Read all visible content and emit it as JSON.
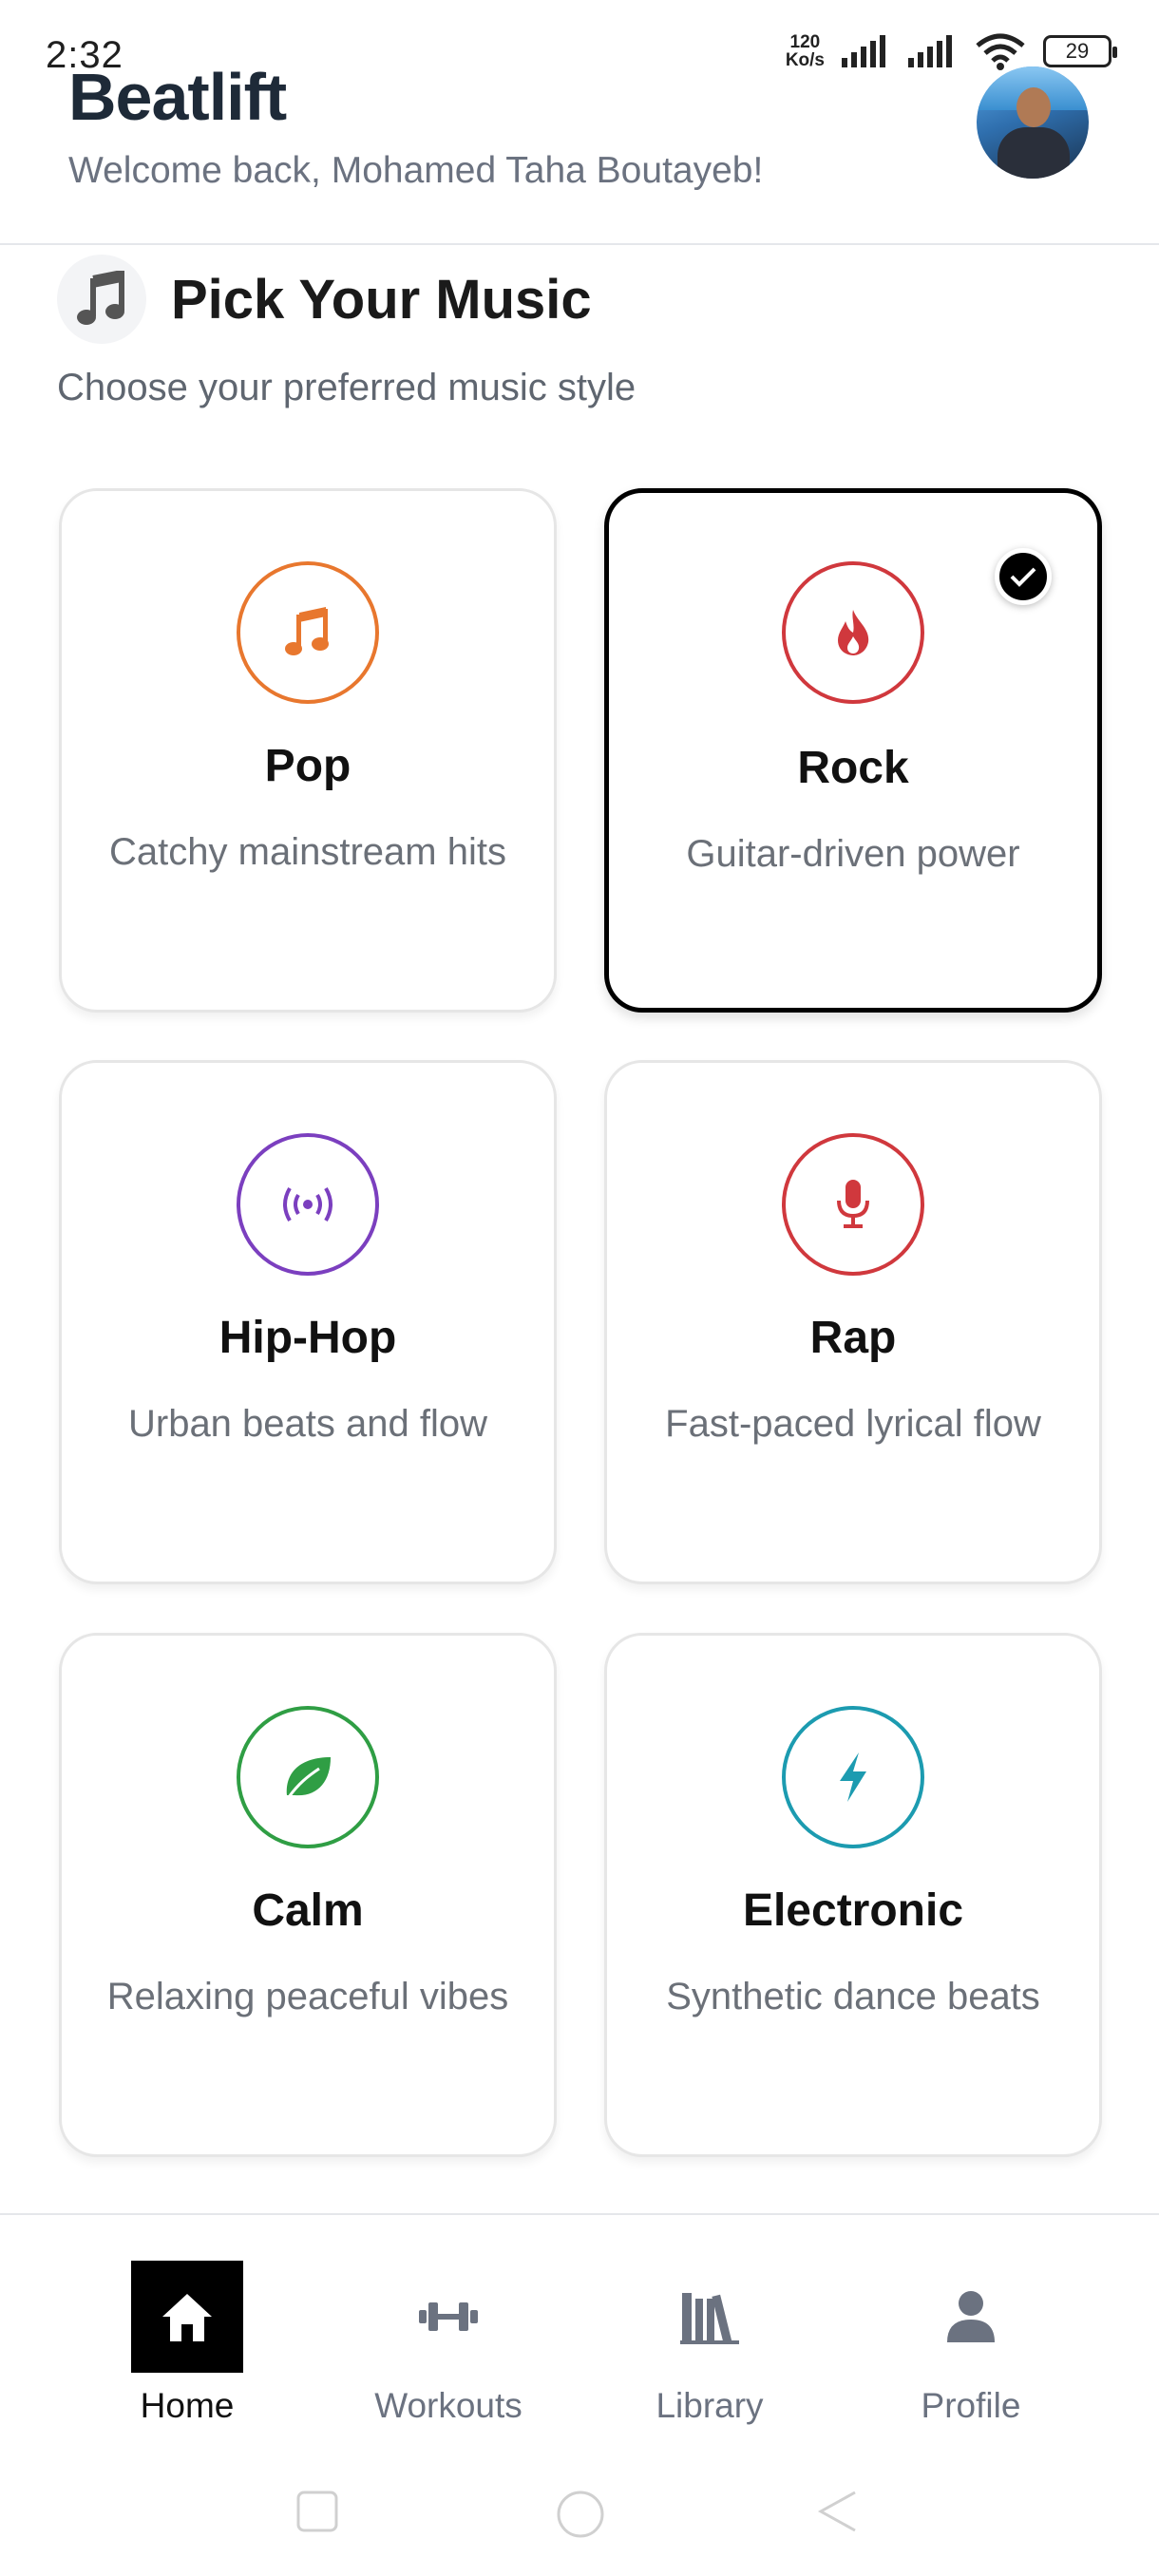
{
  "status_bar": {
    "time": "2:32",
    "net_speed_value": "120",
    "net_speed_unit": "Ko/s",
    "battery": "29"
  },
  "header": {
    "app_title": "Beatlift",
    "welcome": "Welcome back, Mohamed Taha Boutayeb!"
  },
  "section": {
    "title": "Pick Your Music",
    "subtitle": "Choose your preferred music style"
  },
  "genres": [
    {
      "title": "Pop",
      "desc": "Catchy mainstream hits",
      "icon": "music-note-icon",
      "color": "#e8772e",
      "selected": false
    },
    {
      "title": "Rock",
      "desc": "Guitar-driven power",
      "icon": "flame-icon",
      "color": "#d0383d",
      "selected": true
    },
    {
      "title": "Hip-Hop",
      "desc": "Urban beats and flow",
      "icon": "broadcast-icon",
      "color": "#7b3fbf",
      "selected": false
    },
    {
      "title": "Rap",
      "desc": "Fast-paced lyrical flow",
      "icon": "microphone-icon",
      "color": "#d0383d",
      "selected": false
    },
    {
      "title": "Calm",
      "desc": "Relaxing peaceful vibes",
      "icon": "leaf-icon",
      "color": "#2f9e44",
      "selected": false
    },
    {
      "title": "Electronic",
      "desc": "Synthetic dance beats",
      "icon": "lightning-icon",
      "color": "#1c9bb0",
      "selected": false
    }
  ],
  "bottom_nav": [
    {
      "label": "Home",
      "icon": "home-icon",
      "active": true
    },
    {
      "label": "Workouts",
      "icon": "dumbbell-icon",
      "active": false
    },
    {
      "label": "Library",
      "icon": "library-icon",
      "active": false
    },
    {
      "label": "Profile",
      "icon": "person-icon",
      "active": false
    }
  ]
}
